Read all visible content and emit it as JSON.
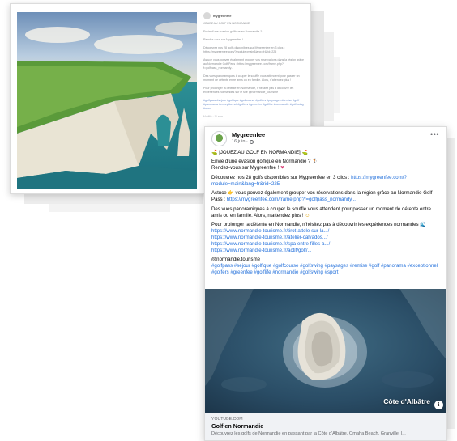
{
  "back_post": {
    "username": "mygreenfee",
    "caption_lines": [
      "JOUEZ AU GOLF EN NORMANDIE",
      "Envie d'une évasion golfique en Normandie ?",
      "Rendez-vous sur Mygreenfee !",
      "Découvrez nos 28 golfs disponibles sur Mygreenfee en 3 clics : https://mygreenfee.com/?module=main&lang=fr&rid=225",
      "Astuce vous pouvez également grouper vos réservations dans la région grâce au Normandie Golf Pass : https://mygreenfee.com/frame.php?f=golfpass_normandy...",
      "Des vues panoramiques à couper le souffle vous attendent pour passer un moment de détente entre amis ou en famille. Alors, n'attendez plus !",
      "Pour prolonger la détente en Normandie, n'hésitez pas à découvrir les expériences normandes sur le site @normandie_tourisme"
    ],
    "hashtags": "#golfpass #sejour #golfique #golfcourse #golfers #paysages #remise #golf #panorama #exceptionnel #golfers #greenfee #golflife #normandie #golfswing #sport",
    "footer": "Modifié · 11 sem."
  },
  "front_post": {
    "author": "Mygreenfee",
    "date": "16 juin ·",
    "headline": "[JOUEZ AU GOLF EN NORMANDIE]",
    "intro_line1": "Envie d'une évasion golfique en Normandie ?",
    "intro_line2": "Rendez-vous sur Mygreenfee !",
    "golfs_text": "Découvrez nos 28 golfs disponibles sur Mygreenfee en 3 clics : ",
    "golfs_link": "https://mygreenfee.com/?module=main&lang=fr&rid=225",
    "tip_text_a": "Astuce",
    "tip_text_b": " vous pouvez également grouper vos réservations dans la région grâce au Normandie Golf Pass : ",
    "tip_link": "https://mygreenfee.com/frame.php?f=golfpass_normandy...",
    "views_text": "Des vues panoramiques à couper le souffle vous attendent pour passer un moment de détente entre amis ou en famille. Alors, n'attendez plus !",
    "extend_text": "Pour prolonger la détente en Normandie, n'hésitez pas à découvrir les expériences normandes",
    "links": [
      "https://www.normandie-tourisme.fr/tirot-attele-sur-la.../",
      "https://www.normandie-tourisme.fr/atelier-calvados.../",
      "https://www.normandie-tourisme.fr/spa-entre-filles-a.../",
      "https://www.normandie-tourisme.fr/actif/golf/..."
    ],
    "mention": "@normandie.tourisme",
    "hashtags": "#golfpass #sejour #golfique #golfcourse #golfswing #paysages #remise #golf #panorama #exceptionnel #golfers #greenfee #golflife #normandie #golfswing #sport",
    "image_caption": "Côte d'Albâtre",
    "info_icon": "i",
    "preview_domain": "YOUTUBE.COM",
    "preview_title": "Golf en Normandie",
    "preview_desc": "Découvrez les golfs de Normandie en passant par la Côte d'Albâtre, Omaha Beach, Granville, l..."
  },
  "colors": {
    "link": "#216fdb",
    "text": "#050505",
    "muted": "#65676b",
    "preview_bg": "#f0f2f5"
  },
  "icons": {
    "golf": "golf-flag-icon",
    "heart": "heart-icon",
    "hand": "pointing-hand-icon",
    "smile": "smile-icon",
    "wave": "wave-icon",
    "globe": "globe-icon",
    "more": "more-options-icon"
  }
}
